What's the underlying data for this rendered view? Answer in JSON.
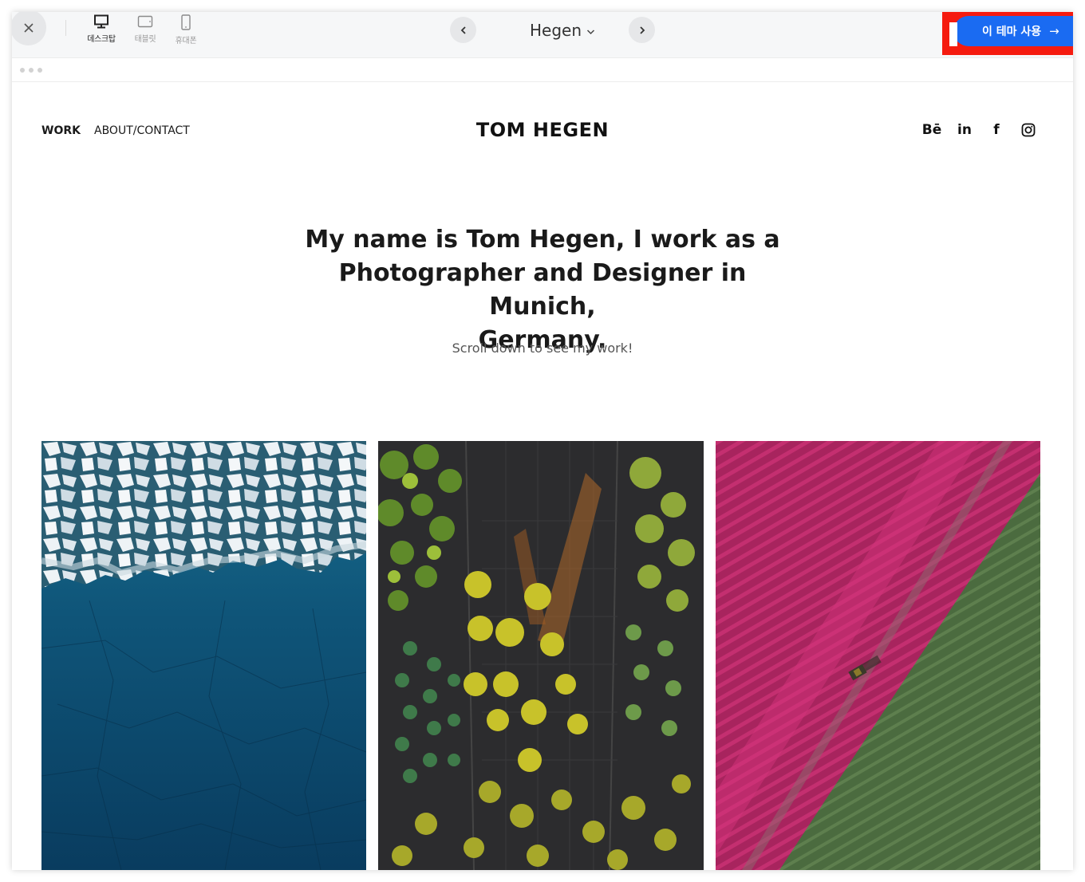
{
  "toolbar": {
    "close_label": "×",
    "devices": [
      {
        "label": "데스크탑",
        "icon": "desktop-icon",
        "active": true
      },
      {
        "label": "태블릿",
        "icon": "tablet-icon",
        "active": false
      },
      {
        "label": "휴대폰",
        "icon": "phone-icon",
        "active": false
      }
    ],
    "theme_name": "Hegen",
    "use_theme_label": "이 테마 사용",
    "use_theme_arrow": "→",
    "accent_color": "#1a6bf2",
    "highlight_color": "#f51b0f"
  },
  "site": {
    "nav": [
      {
        "label": "WORK",
        "active": true
      },
      {
        "label": "ABOUT/CONTACT",
        "active": false
      }
    ],
    "brand": "TOM HEGEN",
    "social": [
      {
        "label": "Bē",
        "icon": "behance-icon"
      },
      {
        "label": "in",
        "icon": "linkedin-icon"
      },
      {
        "label": "f",
        "icon": "facebook-icon"
      },
      {
        "label": "",
        "icon": "instagram-icon"
      }
    ],
    "hero_lines": [
      "My name is Tom Hegen, I work as a",
      "Photographer and Designer in Munich,",
      "Germany."
    ],
    "subheading": "Scroll down to see my work!",
    "photos": [
      {
        "subject": "aerial-ice-floes-ocean"
      },
      {
        "subject": "aerial-tree-nursery"
      },
      {
        "subject": "aerial-tulip-fields-tractor"
      }
    ]
  }
}
